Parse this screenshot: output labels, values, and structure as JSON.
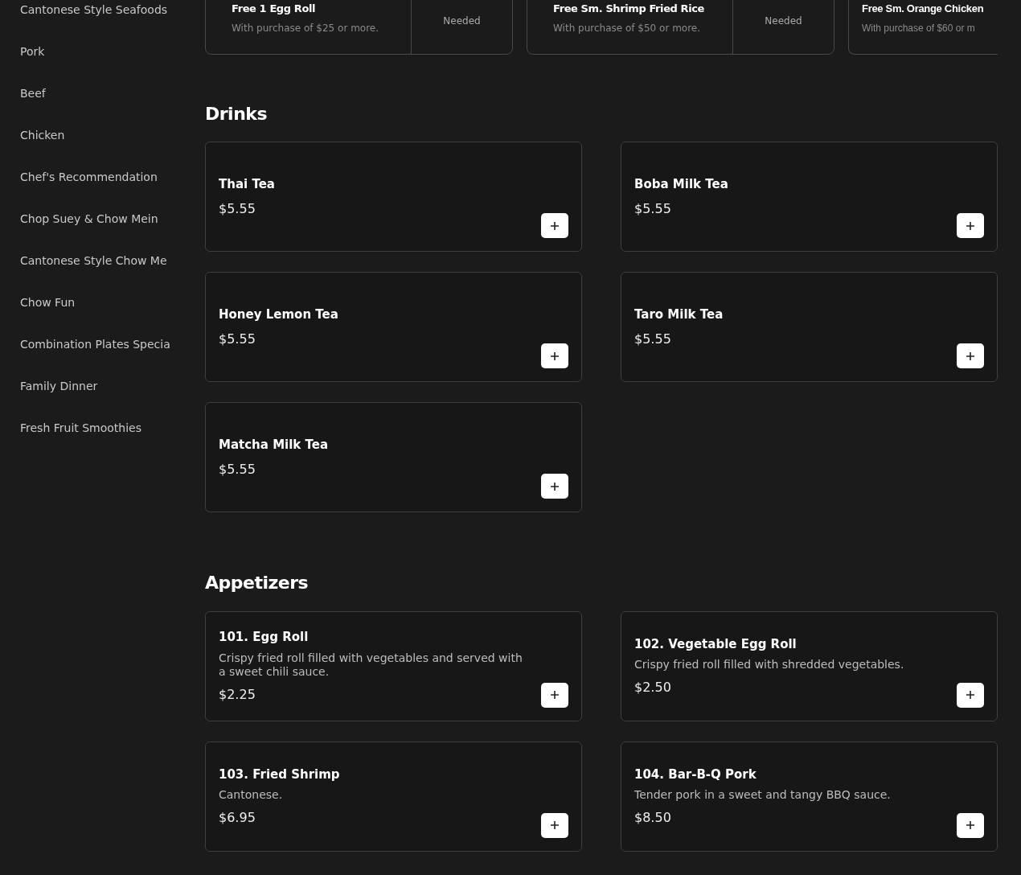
{
  "sidebar": {
    "items": [
      {
        "label": "Cantonese Style Seafoods"
      },
      {
        "label": "Pork"
      },
      {
        "label": "Beef"
      },
      {
        "label": "Chicken"
      },
      {
        "label": "Chef's Recommendation"
      },
      {
        "label": "Chop Suey & Chow Mein"
      },
      {
        "label": "Cantonese Style Chow Me"
      },
      {
        "label": "Chow Fun"
      },
      {
        "label": "Combination Plates Specia"
      },
      {
        "label": "Family Dinner"
      },
      {
        "label": "Fresh Fruit Smoothies"
      }
    ]
  },
  "coupons": [
    {
      "title": "Free 1 Egg Roll",
      "condition": "With purchase of $25 or more.",
      "status": "Needed"
    },
    {
      "title": "Free Sm. Shrimp Fried Rice",
      "condition": "With purchase of $50 or more.",
      "status": "Needed"
    },
    {
      "title": "Free Sm. Orange Chicken",
      "condition": "With purchase of $60 or m"
    }
  ],
  "sections": [
    {
      "title": "Drinks",
      "items": [
        {
          "name": "Thai Tea",
          "price": "$5.55"
        },
        {
          "name": "Boba Milk Tea",
          "price": "$5.55"
        },
        {
          "name": "Honey Lemon Tea",
          "price": "$5.55"
        },
        {
          "name": "Taro Milk Tea",
          "price": "$5.55"
        },
        {
          "name": "Matcha Milk Tea",
          "price": "$5.55"
        }
      ]
    },
    {
      "title": "Appetizers",
      "items": [
        {
          "name": "101. Egg Roll",
          "description": "Crispy fried roll filled with vegetables and served with a sweet chili sauce.",
          "price": "$2.25"
        },
        {
          "name": "102. Vegetable Egg Roll",
          "description": "Crispy fried roll filled with shredded vegetables.",
          "price": "$2.50"
        },
        {
          "name": "103. Fried Shrimp",
          "description": "Cantonese.",
          "price": "$6.95"
        },
        {
          "name": "104. Bar-B-Q Pork",
          "description": "Tender pork in a sweet and tangy BBQ sauce.",
          "price": "$8.50"
        }
      ]
    }
  ]
}
